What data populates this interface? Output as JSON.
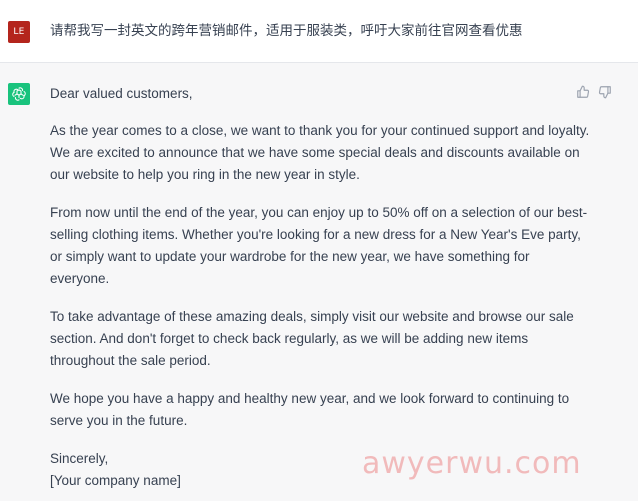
{
  "user_message": {
    "avatar_initials": "LE",
    "text": "请帮我写一封英文的跨年营销邮件，适用于服装类，呼吁大家前往官网查看优惠"
  },
  "assistant_message": {
    "greeting": "Dear valued customers,",
    "paragraphs": [
      "As the year comes to a close, we want to thank you for your continued support and loyalty. We are excited to announce that we have some special deals and discounts available on our website to help you ring in the new year in style.",
      "From now until the end of the year, you can enjoy up to 50% off on a selection of our best-selling clothing items. Whether you're looking for a new dress for a New Year's Eve party, or simply want to update your wardrobe for the new year, we have something for everyone.",
      "To take advantage of these amazing deals, simply visit our website and browse our sale section. And don't forget to check back regularly, as we will be adding new items throughout the sale period.",
      "We hope you have a happy and healthy new year, and we look forward to continuing to serve you in the future."
    ],
    "closing": "Sincerely,",
    "signature": "[Your company name]"
  },
  "watermark": "awyerwu.com",
  "colors": {
    "user_avatar": "#b4251d",
    "assistant_avatar": "#19c37d",
    "text": "#374151",
    "background": "#f7f7f8"
  },
  "icons": {
    "assistant_avatar": "openai-logo-icon",
    "like": "thumbs-up-icon",
    "dislike": "thumbs-down-icon"
  }
}
